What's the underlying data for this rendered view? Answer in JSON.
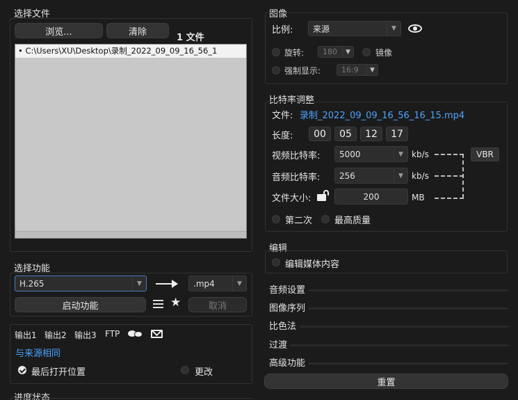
{
  "file_panel": {
    "title": "选择文件",
    "browse_label": "浏览...",
    "clear_label": "清除",
    "count_label": "1 文件",
    "files": [
      "• C:\\Users\\XU\\Desktop\\录制_2022_09_09_16_56_1"
    ]
  },
  "function_panel": {
    "title": "选择功能",
    "codec_value": "H.265",
    "format_value": ".mp4",
    "start_label": "启动功能",
    "cancel_label": "取消"
  },
  "output_panel": {
    "tabs": [
      "输出1",
      "输出2",
      "输出3",
      "FTP"
    ],
    "same_as_source_label": "与来源相同",
    "open_last_label": "最后打开位置",
    "change_label": "更改"
  },
  "progress_panel": {
    "title": "进度状态"
  },
  "image_panel": {
    "title": "图像",
    "ratio_label": "比例:",
    "ratio_value": "来源",
    "rotate_label": "旋转:",
    "rotate_value": "180",
    "mirror_label": "镜像",
    "force_label": "强制显示:",
    "force_value": "16:9"
  },
  "bitrate_panel": {
    "title": "比特率调整",
    "file_label": "文件:",
    "file_name": "录制_2022_09_09_16_56_16_15.mp4",
    "length_label": "长度:",
    "length": [
      "00",
      "05",
      "12",
      "17"
    ],
    "video_label": "视频比特率:",
    "video_value": "5000",
    "audio_label": "音频比特率:",
    "audio_value": "256",
    "size_label": "文件大小:",
    "size_value": "200",
    "unit_kbs": "kb/s",
    "unit_mb": "MB",
    "vbr_label": "VBR",
    "second_pass_label": "第二次",
    "best_quality_label": "最高质量"
  },
  "edit_panel": {
    "title": "编辑",
    "edit_media_label": "编辑媒体内容"
  },
  "sections": [
    "音频设置",
    "图像序列",
    "比色法",
    "过渡",
    "高级功能"
  ],
  "reset_label": "重置",
  "colors": {
    "accent": "#4aa3ff",
    "background": "#1b1b1b"
  }
}
